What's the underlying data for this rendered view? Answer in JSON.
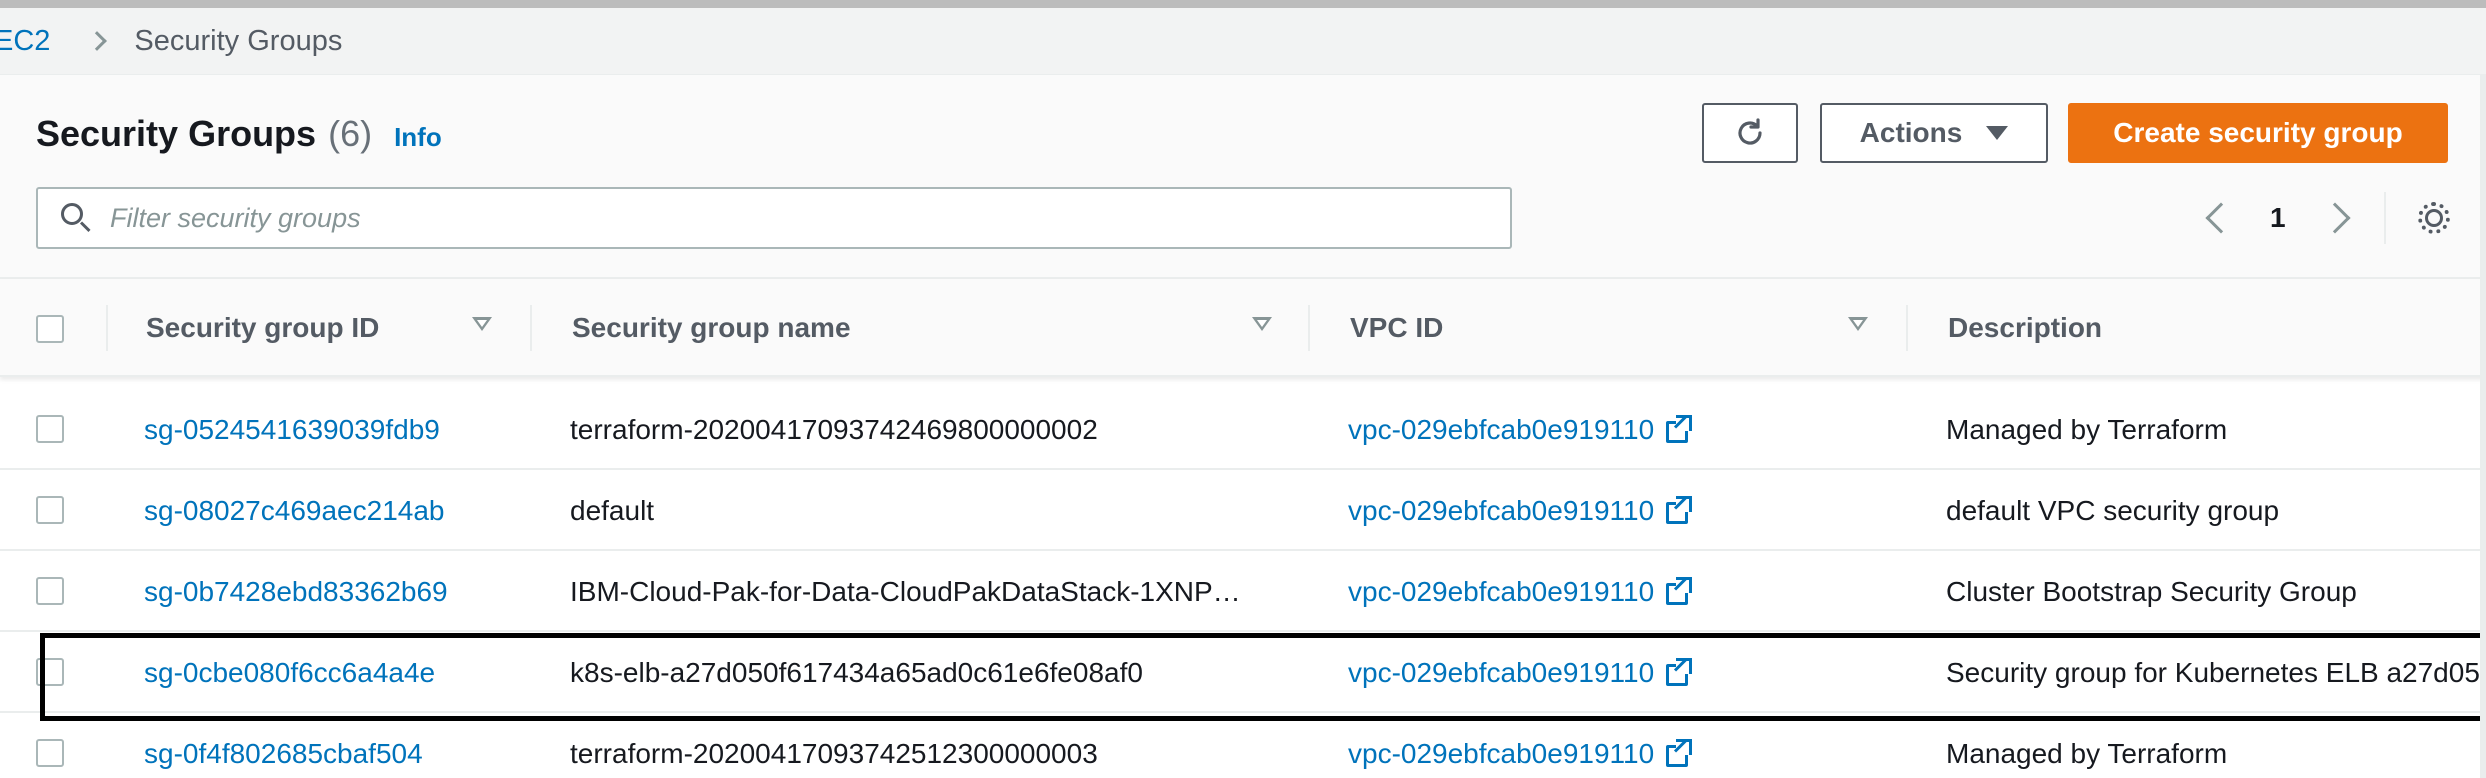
{
  "breadcrumb": {
    "root": "EC2",
    "current": "Security Groups"
  },
  "header": {
    "title": "Security Groups",
    "count": "(6)",
    "info_label": "Info"
  },
  "toolbar": {
    "refresh_icon": "refresh-icon",
    "actions_label": "Actions",
    "create_label": "Create security group"
  },
  "search": {
    "placeholder": "Filter security groups",
    "value": ""
  },
  "pagination": {
    "current_page": "1"
  },
  "table": {
    "columns": [
      {
        "label": "Security group ID"
      },
      {
        "label": "Security group name"
      },
      {
        "label": "VPC ID"
      },
      {
        "label": "Description"
      }
    ],
    "rows": [
      {
        "id": "sg-0524541639039fdb9",
        "name": "terraform-20200417093742469800000002",
        "vpc": "vpc-029ebfcab0e919110",
        "description": "Managed by Terraform"
      },
      {
        "id": "sg-08027c469aec214ab",
        "name": "default",
        "vpc": "vpc-029ebfcab0e919110",
        "description": "default VPC security group"
      },
      {
        "id": "sg-0b7428ebd83362b69",
        "name": "IBM-Cloud-Pak-for-Data-CloudPakDataStack-1XNP…",
        "vpc": "vpc-029ebfcab0e919110",
        "description": "Cluster Bootstrap Security Group"
      },
      {
        "id": "sg-0cbe080f6cc6a4a4e",
        "name": "k8s-elb-a27d050f617434a65ad0c61e6fe08af0",
        "vpc": "vpc-029ebfcab0e919110",
        "description": "Security group for Kubernetes ELB a27d05"
      },
      {
        "id": "sg-0f4f802685cbaf504",
        "name": "terraform-20200417093742512300000003",
        "vpc": "vpc-029ebfcab0e919110",
        "description": "Managed by Terraform"
      }
    ]
  },
  "colors": {
    "link": "#0073bb",
    "primary_button": "#ec7211",
    "header_bg": "#fafafa",
    "border": "#eaeded"
  }
}
